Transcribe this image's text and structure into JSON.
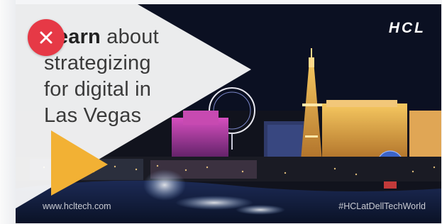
{
  "ad": {
    "headline_bold": "Learn",
    "headline_rest": "about",
    "headline_line2": "strategizing",
    "headline_line3": "for digital in",
    "headline_line4": "Las Vegas",
    "logo_text": "HCL",
    "footer_url": "www.hcltech.com",
    "footer_hashtag": "#HCLatDellTechWorld"
  },
  "colors": {
    "close_button": "#e63946",
    "overlay_white": "#ffffff",
    "play_triangle": "#f2b134",
    "sky": "#0c1226"
  },
  "icons": {
    "close": "close-icon",
    "play": "play-triangle-icon"
  }
}
